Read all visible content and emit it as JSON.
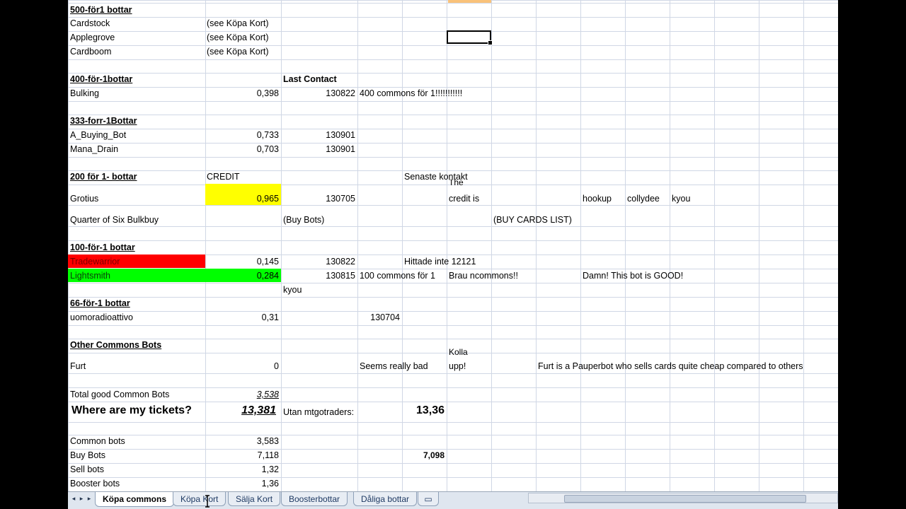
{
  "colors": {
    "yellow": "#ffff00",
    "red": "#ff0000",
    "green": "#00ff00",
    "orange": "#f9c27a",
    "grid": "#d0d7e5"
  },
  "cells": {
    "h500": "500-för1 bottar",
    "cardstock": "Cardstock",
    "cardstock_note": "(see Köpa Kort)",
    "applegrove": "Applegrove",
    "applegrove_note": "(see Köpa Kort)",
    "cardboom": "Cardboom",
    "cardboom_note": "(see Köpa Kort)",
    "h400": "400-för-1bottar",
    "last_contact": "Last Contact",
    "bulking": "Bulking",
    "bulking_val": "0,398",
    "bulking_date": "130822",
    "bulking_note": "400 commons för 1!!!!!!!!!!!",
    "h333": "333-forr-1Bottar",
    "abuying": "A_Buying_Bot",
    "abuying_val": "0,733",
    "abuying_date": "130901",
    "manadrain": "Mana_Drain",
    "manadrain_val": "0,703",
    "manadrain_date": "130901",
    "h200": "200 för 1- bottar",
    "credit": "CREDIT",
    "senaste": "Senaste kontakt",
    "grotius": "Grotius",
    "grotius_val": "0,965",
    "grotius_date": "130705",
    "the": "The",
    "credit_is": "credit is",
    "hookup": "hookup",
    "collydee": "collydee",
    "kyou1": "kyou",
    "quarter": "Quarter of Six Bulkbuy",
    "buybots_note": "(Buy Bots)",
    "buycards": "(BUY CARDS LIST)",
    "h100": "100-för-1 bottar",
    "tradewarrior": "Tradewarrior",
    "tradewarrior_val": "0,145",
    "tradewarrior_date": "130822",
    "hittade": "Hittade inte 12121",
    "lightsmith": "Lightsmith",
    "lightsmith_val": "0,284",
    "lightsmith_date": "130815",
    "lightsmith_note": "100 commons för 1",
    "brau": "Brau ncommons!!",
    "damn": "Damn! This bot is GOOD!",
    "kyou2": "kyou",
    "h66": "66-för-1 bottar",
    "uomo": "uomoradioattivo",
    "uomo_val": "0,31",
    "uomo_date": "130704",
    "hother": "Other Commons Bots",
    "furt": "Furt",
    "furt_val": "0",
    "seems": "Seems really bad",
    "kolla": "Kolla",
    "upp": "upp!",
    "furt_note": "Furt is a Pauperbot who sells cards quite cheap compared to others",
    "total_label": "Total good Common Bots",
    "total_val": "3,538",
    "where": "Where are my tickets?",
    "where_val": "13,381",
    "utan": "Utan mtgotraders:",
    "utan_val": "13,36",
    "common": "Common bots",
    "common_val": "3,583",
    "buy": "Buy Bots",
    "buy_val": "7,118",
    "buy_val2": "7,098",
    "sell": "Sell bots",
    "sell_val": "1,32",
    "booster": "Booster bots",
    "booster_val": "1,36"
  },
  "tabs": {
    "t1": "Köpa commons",
    "t2": "Köpa Kort",
    "t3": "Sälja Kort",
    "t4": "Boosterbottar",
    "t5": "Dåliga bottar"
  }
}
